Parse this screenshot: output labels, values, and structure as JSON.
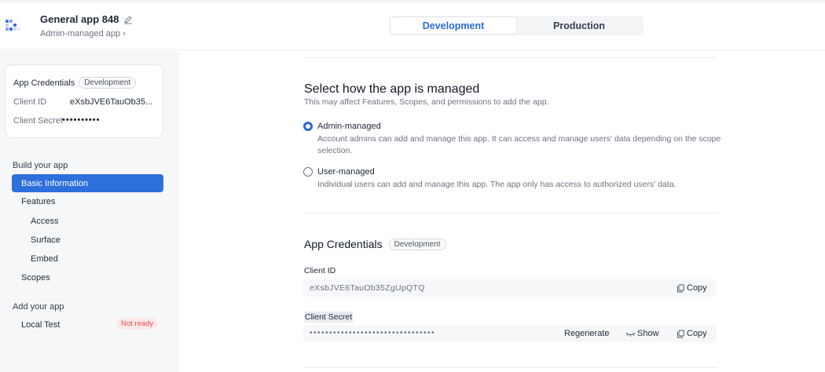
{
  "header": {
    "app_name": "General app 848",
    "app_type": "Admin-managed app",
    "env_tabs": [
      "Development",
      "Production"
    ],
    "active_env": "Development"
  },
  "sidebar": {
    "credentials": {
      "title": "App Credentials",
      "badge": "Development",
      "client_id_label": "Client ID",
      "client_id_value": "eXsbJVE6TauOb35...",
      "client_secret_label": "Client Secret",
      "client_secret_value": "••••••••••"
    },
    "build_group": "Build your app",
    "items": {
      "basic_information": "Basic Information",
      "features": "Features",
      "access": "Access",
      "surface": "Surface",
      "embed": "Embed",
      "scopes": "Scopes"
    },
    "add_group": "Add your app",
    "local_test": "Local Test",
    "local_test_status": "Not ready"
  },
  "main": {
    "management": {
      "title": "Select how the app is managed",
      "description": "This may affect Features, Scopes, and permissions to add the app.",
      "options": [
        {
          "label": "Admin-managed",
          "description": "Account admins can add and manage this app. It can access and manage users' data depending on the scope selection.",
          "selected": true
        },
        {
          "label": "User-managed",
          "description": "Individual users can add and manage this app. The app only has access to authorized users' data.",
          "selected": false
        }
      ]
    },
    "credentials": {
      "title": "App Credentials",
      "badge": "Development",
      "client_id_label": "Client ID",
      "client_id_value": "eXsbJVE6TauOb35ZgUpQTQ",
      "client_secret_label": "Client Secret",
      "client_secret_value": "••••••••••••••••••••••••••••••••",
      "copy_label": "Copy",
      "regenerate_label": "Regenerate",
      "show_label": "Show"
    }
  },
  "colors": {
    "accent": "#2d6fdb",
    "sidebar_bg": "#f6f7f9",
    "not_ready_text": "#d9534f",
    "not_ready_bg": "#fde8e8"
  }
}
